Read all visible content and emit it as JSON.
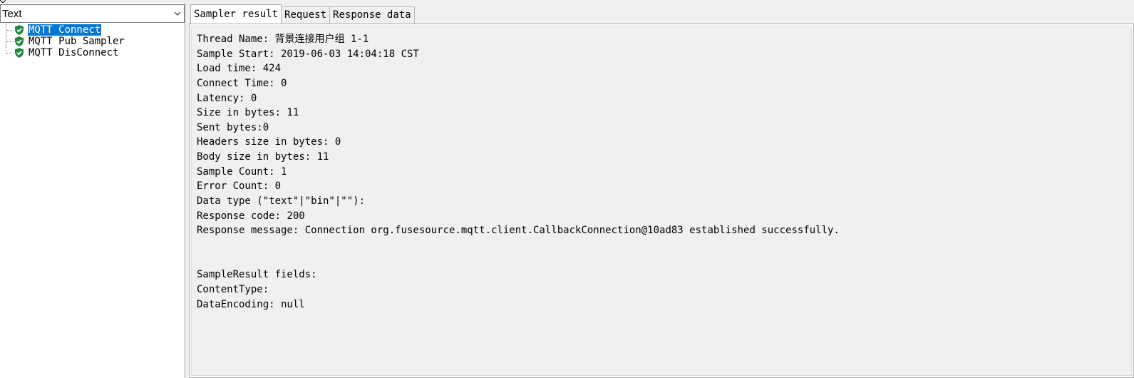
{
  "renderer": {
    "selected": "Text"
  },
  "tree": {
    "items": [
      {
        "label": "MQTT Connect",
        "status": "success",
        "selected": true
      },
      {
        "label": "MQTT Pub Sampler",
        "status": "success",
        "selected": false
      },
      {
        "label": "MQTT DisConnect",
        "status": "success",
        "selected": false
      }
    ]
  },
  "tabs": [
    {
      "label": "Sampler result",
      "active": true
    },
    {
      "label": "Request",
      "active": false
    },
    {
      "label": "Response data",
      "active": false
    }
  ],
  "sampler_result": {
    "lines": [
      "Thread Name: 背景连接用户组 1-1",
      "Sample Start: 2019-06-03 14:04:18 CST",
      "Load time: 424",
      "Connect Time: 0",
      "Latency: 0",
      "Size in bytes: 11",
      "Sent bytes:0",
      "Headers size in bytes: 0",
      "Body size in bytes: 11",
      "Sample Count: 1",
      "Error Count: 0",
      "Data type (\"text\"|\"bin\"|\"\"): ",
      "Response code: 200",
      "Response message: Connection org.fusesource.mqtt.client.CallbackConnection@10ad83 established successfully.",
      "",
      "",
      "SampleResult fields:",
      "ContentType: ",
      "DataEncoding: null"
    ]
  },
  "colors": {
    "selection": "#0078d7",
    "success_icon": "#1e8e3e",
    "background": "#f0f0f0"
  },
  "icons": {
    "status": "shield-check-icon",
    "dropdown": "chevron-down-icon"
  }
}
